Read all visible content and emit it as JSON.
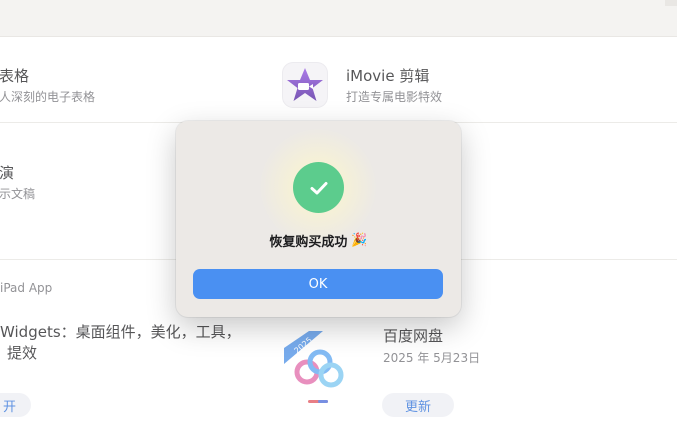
{
  "background": {
    "row1_left": {
      "title": "表格",
      "subtitle": "人深刻的电子表格"
    },
    "row1_right": {
      "title": "iMovie 剪辑",
      "subtitle": "打造专属电影特效"
    },
    "row2_left": {
      "title": "演",
      "subtitle": "示文稿"
    },
    "section_label": "iPad App",
    "widgets": {
      "line1": "Widgets：桌面组件，美化，工具，",
      "line2": "提效",
      "button": "开"
    },
    "baidu": {
      "title": "百度网盘",
      "date": "2025 年 5月23日",
      "button": "更新",
      "badge": "2025"
    }
  },
  "dialog": {
    "message": "恢复购买成功",
    "emoji": "🎉",
    "ok_label": "OK"
  },
  "colors": {
    "success_green": "#5ccc8d",
    "button_blue": "#4a90f2",
    "link_blue": "#2a6ed8",
    "imovie_purple": "#6a2fb8"
  }
}
